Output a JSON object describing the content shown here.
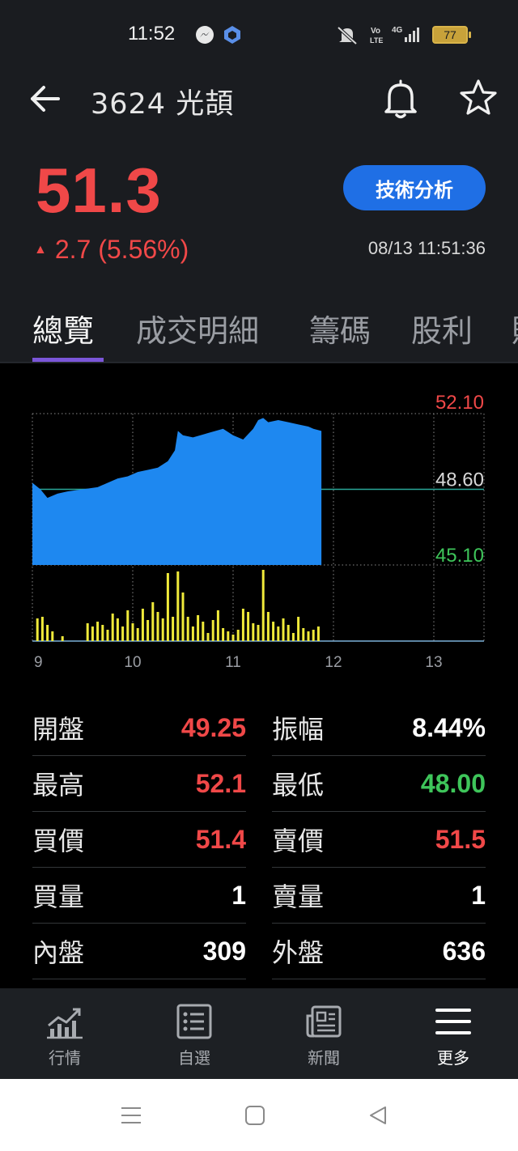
{
  "status_bar": {
    "time": "11:52",
    "battery": "77",
    "network": "4G"
  },
  "header": {
    "title": "3624 光頡"
  },
  "quote": {
    "price": "51.3",
    "change": "2.7 (5.56%)",
    "timestamp": "08/13 11:51:36",
    "technical_button": "技術分析",
    "up_color": "#f04848"
  },
  "tabs": [
    "總覽",
    "成交明細",
    "籌碼",
    "股利"
  ],
  "chart_data": {
    "type": "area",
    "x_ticks": [
      "9",
      "10",
      "11",
      "12",
      "13"
    ],
    "y_ticks": {
      "high": "52.10",
      "ref": "48.60",
      "low": "45.10"
    },
    "ylim": [
      45.1,
      52.1
    ],
    "reference": 48.6,
    "price_series": {
      "x": [
        9.0,
        9.08,
        9.15,
        9.25,
        9.35,
        9.5,
        9.65,
        9.75,
        9.85,
        9.95,
        10.05,
        10.15,
        10.25,
        10.35,
        10.42,
        10.45,
        10.5,
        10.6,
        10.75,
        10.9,
        11.0,
        11.05,
        11.1,
        11.2,
        11.25,
        11.3,
        11.35,
        11.45,
        11.55,
        11.65,
        11.75,
        11.8,
        11.88
      ],
      "y": [
        48.9,
        48.6,
        48.2,
        48.4,
        48.5,
        48.6,
        48.7,
        48.9,
        49.1,
        49.2,
        49.4,
        49.5,
        49.6,
        49.9,
        50.4,
        51.3,
        51.1,
        51.0,
        51.2,
        51.4,
        51.1,
        51.0,
        50.9,
        51.4,
        51.8,
        51.9,
        51.7,
        51.8,
        51.7,
        51.6,
        51.5,
        51.4,
        51.3
      ]
    },
    "volume_series": {
      "x": [
        9.05,
        9.1,
        9.15,
        9.2,
        9.3,
        9.55,
        9.6,
        9.65,
        9.7,
        9.75,
        9.8,
        9.85,
        9.9,
        9.95,
        10.0,
        10.05,
        10.1,
        10.15,
        10.2,
        10.25,
        10.3,
        10.35,
        10.4,
        10.45,
        10.5,
        10.55,
        10.6,
        10.65,
        10.7,
        10.75,
        10.8,
        10.85,
        10.9,
        10.95,
        11.0,
        11.05,
        11.1,
        11.15,
        11.2,
        11.25,
        11.3,
        11.35,
        11.4,
        11.45,
        11.5,
        11.55,
        11.6,
        11.65,
        11.7,
        11.75,
        11.8,
        11.85
      ],
      "y": [
        28,
        30,
        20,
        12,
        6,
        22,
        18,
        24,
        20,
        14,
        34,
        28,
        18,
        38,
        22,
        16,
        40,
        26,
        48,
        36,
        28,
        84,
        30,
        86,
        60,
        30,
        18,
        32,
        24,
        10,
        26,
        38,
        16,
        12,
        8,
        14,
        40,
        36,
        22,
        20,
        88,
        36,
        24,
        18,
        28,
        20,
        10,
        30,
        16,
        12,
        14,
        18
      ]
    }
  },
  "stats": [
    {
      "l_label": "開盤",
      "l_value": "49.25",
      "l_color": "#f04848",
      "r_label": "振幅",
      "r_value": "8.44%",
      "r_color": "#ffffff"
    },
    {
      "l_label": "最高",
      "l_value": "52.1",
      "l_color": "#f04848",
      "r_label": "最低",
      "r_value": "48.00",
      "r_color": "#3ec55a"
    },
    {
      "l_label": "買價",
      "l_value": "51.4",
      "l_color": "#f04848",
      "r_label": "賣價",
      "r_value": "51.5",
      "r_color": "#f04848"
    },
    {
      "l_label": "買量",
      "l_value": "1",
      "l_color": "#ffffff",
      "r_label": "賣量",
      "r_value": "1",
      "r_color": "#ffffff"
    },
    {
      "l_label": "內盤",
      "l_value": "309",
      "l_color": "#ffffff",
      "r_label": "外盤",
      "r_value": "636",
      "r_color": "#ffffff"
    }
  ],
  "bottom_nav": [
    {
      "label": "行情",
      "icon": "chart-icon"
    },
    {
      "label": "自選",
      "icon": "list-icon"
    },
    {
      "label": "新聞",
      "icon": "news-icon"
    },
    {
      "label": "更多",
      "icon": "menu-icon"
    }
  ]
}
